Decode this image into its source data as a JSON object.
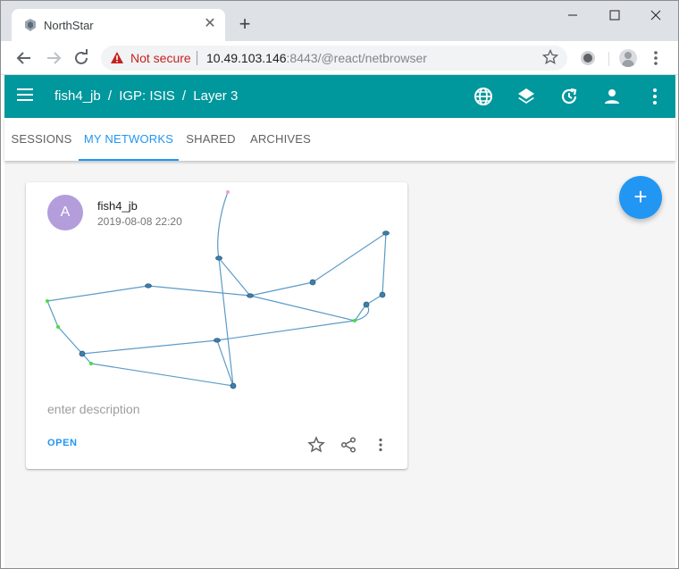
{
  "browser": {
    "tab_title": "NorthStar",
    "new_tab": "+",
    "tab_close": "✕",
    "security_label": "Not secure",
    "url_host": "10.49.103.146",
    "url_rest": ":8443/@react/netbrowser",
    "icons": [
      "minimize-icon",
      "maximize-icon",
      "close-window-icon",
      "back-arrow-icon",
      "forward-arrow-icon",
      "reload-icon",
      "warning-icon",
      "bookmark-star-icon",
      "extension-icon",
      "profile-icon",
      "chrome-menu-icon"
    ]
  },
  "appbar": {
    "breadcrumbs": [
      "fish4_jb",
      "/",
      "IGP: ISIS",
      "/",
      "Layer 3"
    ],
    "color": "#00979d",
    "icons": [
      "globe-icon",
      "layers-icon",
      "history-icon",
      "account-icon",
      "more-vert-icon"
    ]
  },
  "tabs": [
    "SESSIONS",
    "MY NETWORKS",
    "SHARED",
    "ARCHIVES"
  ],
  "active_tab": "MY NETWORKS",
  "card": {
    "avatar_letter": "A",
    "title": "fish4_jb",
    "date": "2019-08-08 22:20",
    "description_placeholder": "enter description",
    "open_label": "OPEN",
    "action_icons": [
      "star-icon",
      "share-icon",
      "more-vert-icon"
    ]
  },
  "fab_label": "+",
  "accent": "#2196f3"
}
